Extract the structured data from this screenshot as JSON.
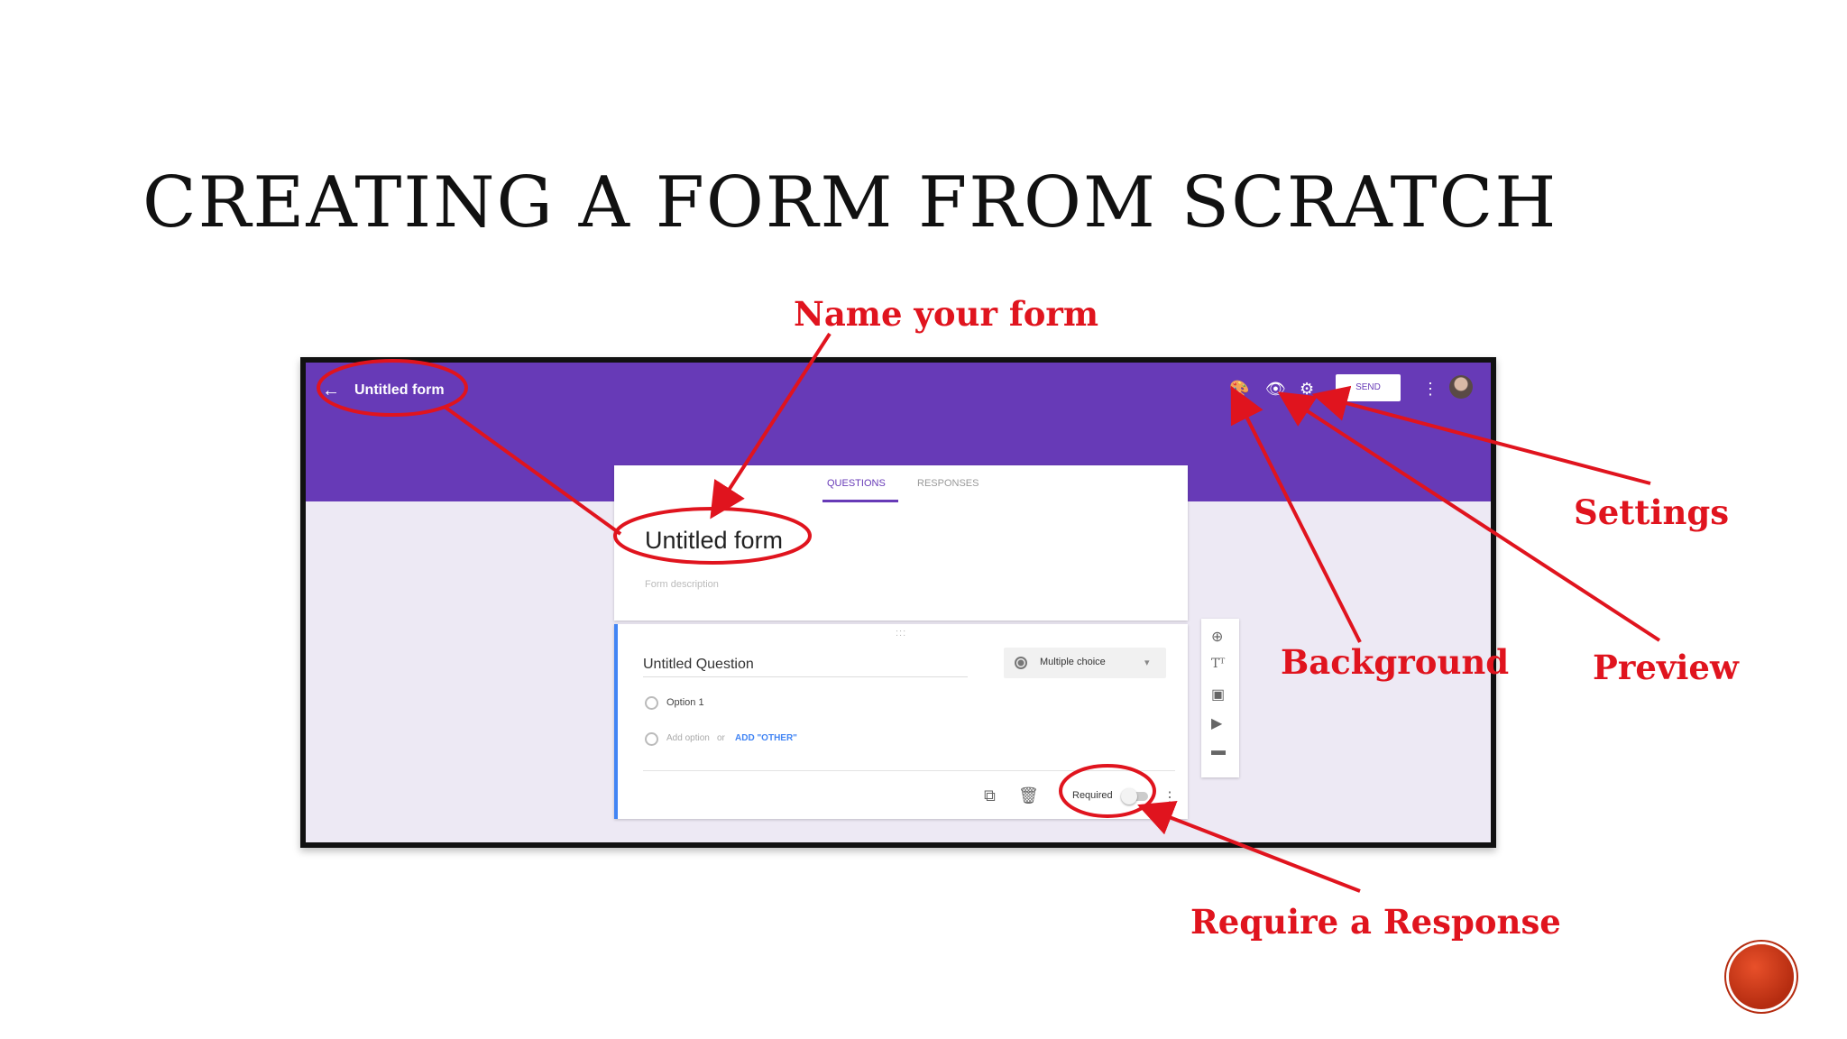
{
  "slide": {
    "title": "CREATING A FORM FROM SCRATCH",
    "callouts": {
      "name_form": "Name your form",
      "settings": "Settings",
      "background": "Background",
      "preview": "Preview",
      "require": "Require a Response"
    },
    "annotation_color": "#e0141e"
  },
  "app": {
    "header": {
      "back_icon": "arrow-left-icon",
      "form_name": "Untitled form",
      "icons": [
        "palette-icon",
        "eye-icon",
        "gear-icon",
        "more-vert-icon"
      ],
      "send_label": "SEND",
      "brand_color": "#673ab7"
    },
    "tabs": [
      {
        "label": "QUESTIONS",
        "active": true
      },
      {
        "label": "RESPONSES",
        "active": false
      }
    ],
    "form": {
      "title": "Untitled form",
      "description_placeholder": "Form description"
    },
    "question": {
      "drag_handle": ":::",
      "title": "Untitled Question",
      "type": "Multiple choice",
      "options": [
        "Option 1"
      ],
      "add_option": "Add option",
      "or_text": "or",
      "add_other": "ADD \"OTHER\"",
      "required_label": "Required",
      "required_on": false
    },
    "side_toolbar": [
      "add-question-icon",
      "title-text-icon",
      "image-icon",
      "video-icon",
      "section-icon"
    ]
  }
}
